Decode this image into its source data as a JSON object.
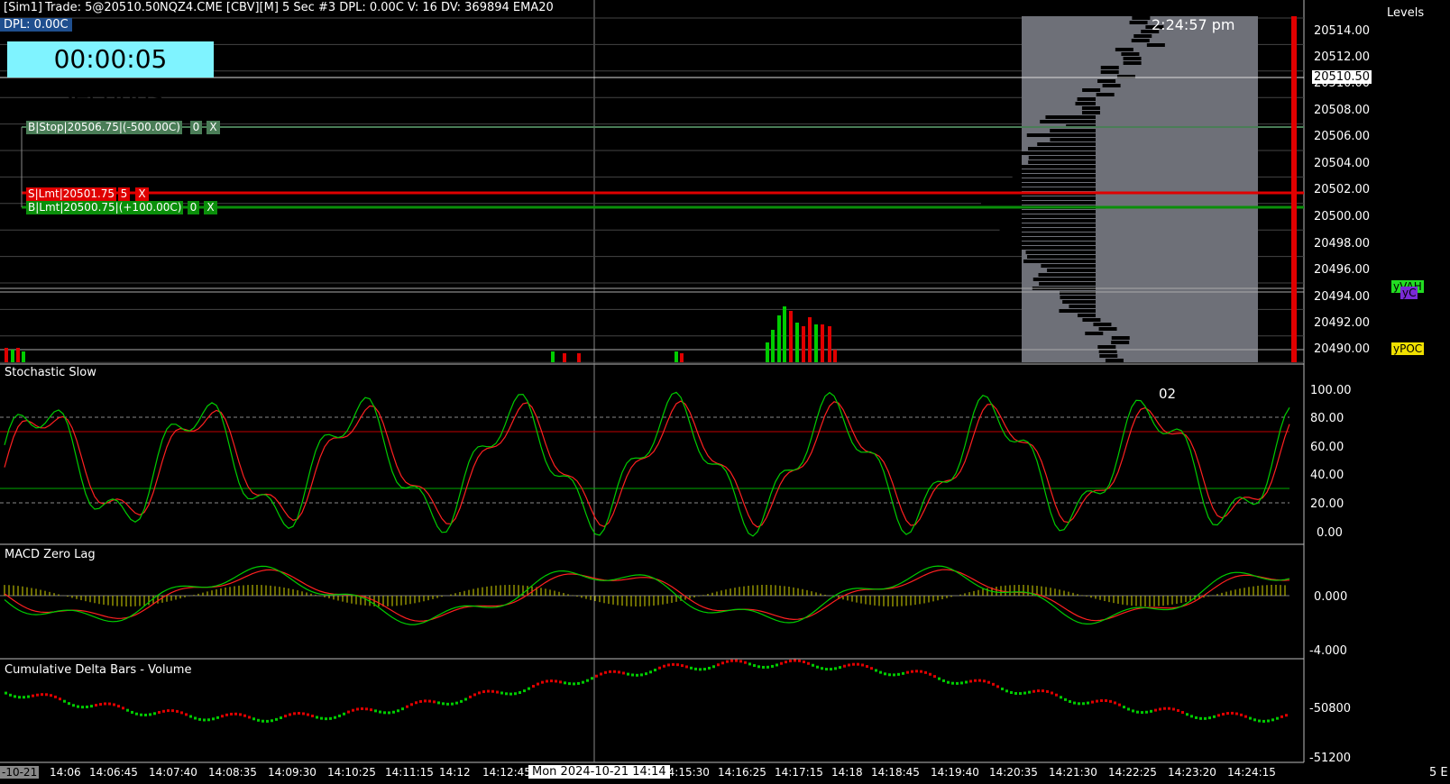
{
  "header": {
    "sim_label": "[Sim1]",
    "trade_label": "Trade: 5@20510.50",
    "instrument_info": "NQZ4.CME [CBV][M]  5 Sec  #3 DPL: 0.00C V: 16 DV: 369894  EMA20",
    "dpl_label": "DPL: 0.00C",
    "bar_timer": "00:00:05 Seconds",
    "clock": "2:24:57 pm",
    "levels_title": "Levels"
  },
  "orders": {
    "buy_stop": {
      "label": "B|Stop|20506.75|(-500.00C)",
      "qty": "0",
      "cancel": "X"
    },
    "sell_limit": {
      "label": "S|Lmt|20501.75",
      "qty": "5",
      "cancel": "X"
    },
    "buy_limit": {
      "label": "B|Lmt|20500.75|(+100.00C)",
      "qty": "0",
      "cancel": "X"
    }
  },
  "price_axis": {
    "labels": [
      "20514.00",
      "20512.00",
      "20510.00",
      "20508.00",
      "20506.00",
      "20504.00",
      "20502.00",
      "20500.00",
      "20498.00",
      "20496.00",
      "20494.00",
      "20492.00",
      "20490.00"
    ],
    "current_price": "20510.50"
  },
  "level_tags": {
    "yvah": "yVAH",
    "yc": "yC",
    "ypoc": "yPOC"
  },
  "studies": {
    "stochastic": {
      "title": "Stochastic Slow",
      "value_tag": "02",
      "axis": [
        "100.00",
        "80.00",
        "60.00",
        "40.00",
        "20.00",
        "0.00"
      ]
    },
    "macd": {
      "title": "MACD Zero Lag",
      "axis": [
        "0.000",
        "-4.000"
      ]
    },
    "cumdelta": {
      "title": "Cumulative Delta Bars - Volume",
      "axis": [
        "-50800",
        "-51200"
      ]
    }
  },
  "time_axis": {
    "labels": [
      "-10-21",
      "14:06",
      "14:06:45",
      "14:07:40",
      "14:08:35",
      "14:09:30",
      "14:10:25",
      "14:11:15",
      "14:12",
      "14:12:45",
      "14:15:30",
      "14:16:25",
      "14:17:15",
      "14:18",
      "14:18:45",
      "14:19:40",
      "14:20:35",
      "14:21:30",
      "14:22:25",
      "14:23:20",
      "14:24:15"
    ],
    "cursor_label": "Mon 2024-10-21  14:14",
    "corner": "5 E"
  },
  "colors": {
    "stop_green": "#4a7d57",
    "sell_red": "#e00000",
    "buy_green": "#0a8f0a",
    "timer_bg": "#7ff3ff",
    "stoch_k": "#00cc00",
    "stoch_d": "#ff2020",
    "volume_profile": "#6e7078"
  }
}
